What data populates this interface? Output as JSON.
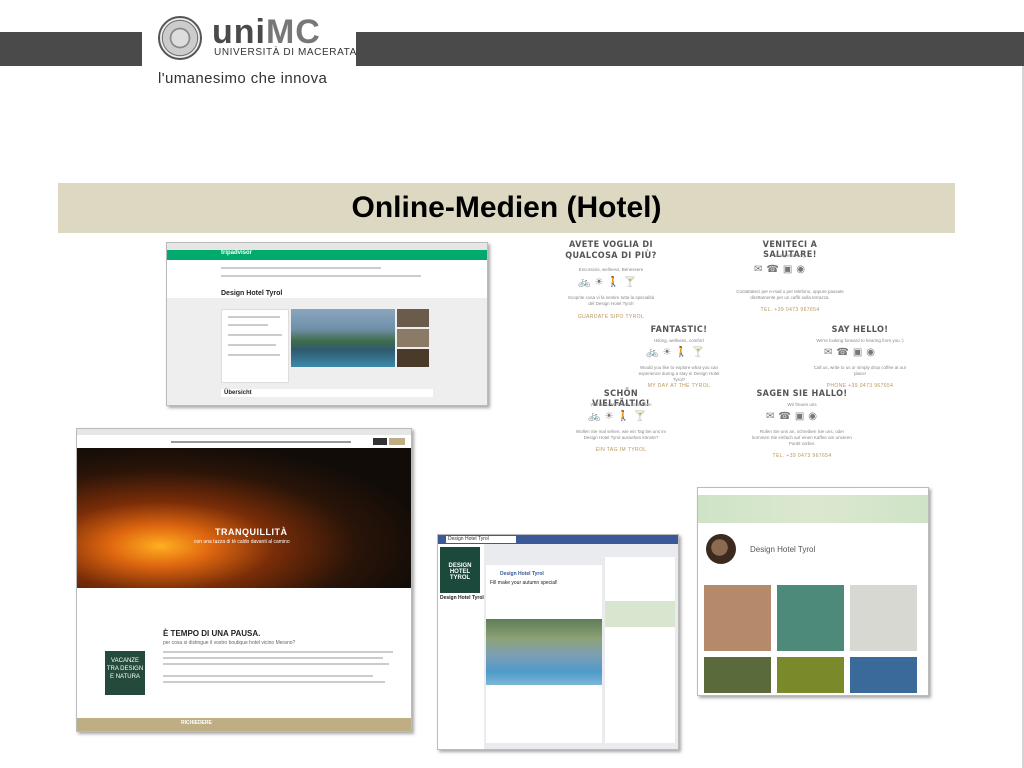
{
  "header": {
    "logo_main": "uni",
    "logo_mc": "MC",
    "logo_sub": "UNIVERSITÀ DI MACERATA",
    "tagline": "l'umanesimo che innova"
  },
  "slide": {
    "title": "Online-Medien (Hotel)"
  },
  "tripadvisor": {
    "logo": "tripadvisor",
    "hotel": "Design Hotel Tyrol",
    "overview": "Übersicht"
  },
  "website": {
    "hero_title": "TRANQUILLITÀ",
    "hero_sub": "con una tazza di tè caldo davanti al camino",
    "heading": "È TEMPO DI UNA PAUSA.",
    "subheading": "per cosa si distingue il vostro boutique hotel vicino Merano?",
    "badge": "VACANZE TRA DESIGN E NATURA",
    "footer": "RICHIEDERE"
  },
  "facebook": {
    "search": "Design Hotel Tyrol",
    "profile_text": "DESIGN HOTEL TYROL",
    "page_name": "Design Hotel Tyrol",
    "post_author": "Design Hotel Tyrol",
    "post_text": "Fill make your autumn special!"
  },
  "instagram": {
    "name": "Design Hotel Tyrol"
  },
  "blocks": [
    {
      "title": "AVETE VOGLIA DI QUALCOSA DI PIÙ?",
      "sub": "Escursioni, wellness, Benessere",
      "text": "Scoprite cosa vi fa sentire tutta la specialità del Design Hotel Tyrol!",
      "link": "GUARDATE SIPO TYROL"
    },
    {
      "title": "VENITECI A SALUTARE!",
      "sub": "Vi aspettiamo ;)",
      "text": "Contattateci per e-mail o per telefono, oppure passate direttamente per un caffè sulla terrazza.",
      "link": "TEL. +39 0473 967654"
    },
    {
      "title": "FANTASTIC!",
      "sub": "Hiking, wellness, comfort",
      "text": "Would you like to explore what you can experience during a stay in Design Hotel Tyrol?",
      "link": "MY DAY AT THE TYROL"
    },
    {
      "title": "SAY HELLO!",
      "sub": "We're looking forward to hearing from you :)",
      "text": "Call us, write to us or simply drop coffee at our place!",
      "link": "PHONE +39 0473 967654"
    },
    {
      "title": "SCHÖN VIELFÄLTIG!",
      "sub": "Wandern, Wellness, Genießen",
      "text": "Wollen Sie mal sehen, wie ein Tag bei uns im Design Hotel Tyrol aussehen könnte?",
      "link": "EIN TAG IM TYROL"
    },
    {
      "title": "SAGEN SIE HALLO!",
      "sub": "Wir freuen uns",
      "text": "Rufen Sie uns an, schreiben Sie uns, oder kommen Sie einfach auf einen Kaffee am unseren Punkt vorbei.",
      "link": "TEL. +39 0473 967654"
    }
  ],
  "icons": {
    "activity": "bike-icon sun-icon hiking-icon cocktail-icon",
    "contact": "mail-icon phone-icon facebook-icon instagram-icon"
  },
  "colors": {
    "header_bar": "#4a4a4a",
    "banner": "#dcd8c1",
    "tripadvisor_green": "#00aa6c",
    "facebook_blue": "#3b5998",
    "gold_link": "#b8965a"
  }
}
